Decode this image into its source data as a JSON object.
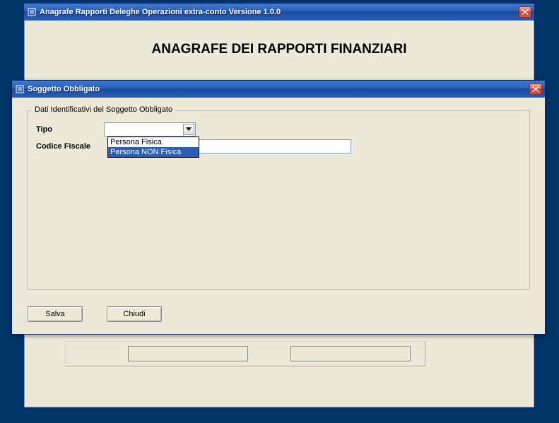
{
  "back_window": {
    "title": "Anagrafe Rapporti Deleghe Operazioni extra-conto Versione 1.0.0",
    "heading": "ANAGRAFE DEI RAPPORTI FINANZIARI",
    "breadcrumb": "",
    "back_btn_1": "",
    "back_btn_2": ""
  },
  "modal": {
    "title": "Soggetto Obbligato",
    "groupbox": "Dati Identificativi del Soggetto Obbligato",
    "labels": {
      "tipo": "Tipo",
      "codice_fiscale": "Codice Fiscale"
    },
    "tipo_value": "",
    "codice_fiscale_value": "",
    "tipo_options": [
      "Persona Fisica",
      "Persona NON Fisica"
    ],
    "tipo_highlighted_index": 1,
    "buttons": {
      "save": "Salva",
      "close": "Chiudi"
    }
  }
}
